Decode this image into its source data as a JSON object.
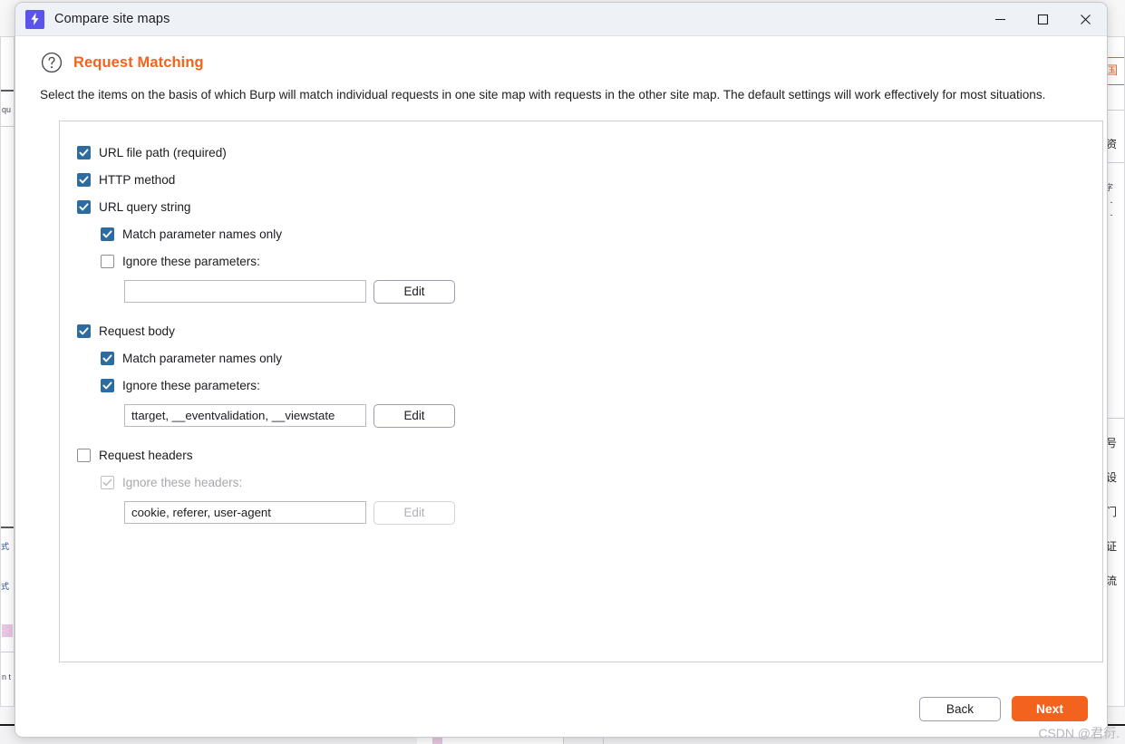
{
  "window": {
    "title": "Compare site maps",
    "app_icon": "lightning-bolt-icon",
    "accent_color": "#5b54ec",
    "controls": {
      "minimize": "minimize-icon",
      "maximize": "maximize-icon",
      "close": "close-icon"
    }
  },
  "header": {
    "help_icon": "question-circle-icon",
    "title": "Request Matching",
    "title_color": "#f4631e",
    "description": "Select the items on the basis of which Burp will match individual requests in one site map with requests in the other site map. The default settings will work effectively for most situations."
  },
  "options": [
    {
      "id": "url-file-path",
      "label": "URL file path (required)",
      "checked": true,
      "enabled": true,
      "indent": 0
    },
    {
      "id": "http-method",
      "label": "HTTP method",
      "checked": true,
      "enabled": true,
      "indent": 0
    },
    {
      "id": "url-query-string",
      "label": "URL query string",
      "checked": true,
      "enabled": true,
      "indent": 0
    },
    {
      "id": "query-match-param-names",
      "label": "Match parameter names only",
      "checked": true,
      "enabled": true,
      "indent": 1
    },
    {
      "id": "query-ignore-params",
      "label": "Ignore these parameters:",
      "checked": false,
      "enabled": true,
      "indent": 1
    },
    {
      "id": "request-body",
      "label": "Request body",
      "checked": true,
      "enabled": true,
      "indent": 0
    },
    {
      "id": "body-match-param-names",
      "label": "Match parameter names only",
      "checked": true,
      "enabled": true,
      "indent": 1
    },
    {
      "id": "body-ignore-params",
      "label": "Ignore these parameters:",
      "checked": true,
      "enabled": true,
      "indent": 1
    },
    {
      "id": "request-headers",
      "label": "Request headers",
      "checked": false,
      "enabled": true,
      "indent": 0
    },
    {
      "id": "headers-ignore",
      "label": "Ignore these headers:",
      "checked": true,
      "enabled": false,
      "indent": 1
    }
  ],
  "fields": {
    "query_params": {
      "value": "",
      "placeholder": "",
      "edit_label": "Edit",
      "enabled": true
    },
    "body_params": {
      "value": "ttarget, __eventvalidation, __viewstate",
      "placeholder": "",
      "edit_label": "Edit",
      "enabled": true
    },
    "headers": {
      "value": "cookie, referer, user-agent",
      "placeholder": "",
      "edit_label": "Edit",
      "enabled": false
    }
  },
  "footer": {
    "back_label": "Back",
    "next_label": "Next",
    "next_color": "#f4631e"
  },
  "watermark": "CSDN @君衍.",
  "background": {
    "right_orange_mark": "国",
    "right_labels": [
      "资",
      "号",
      "设",
      "门",
      "证",
      "流"
    ],
    "left_labels": [
      "qu",
      "n t"
    ]
  }
}
